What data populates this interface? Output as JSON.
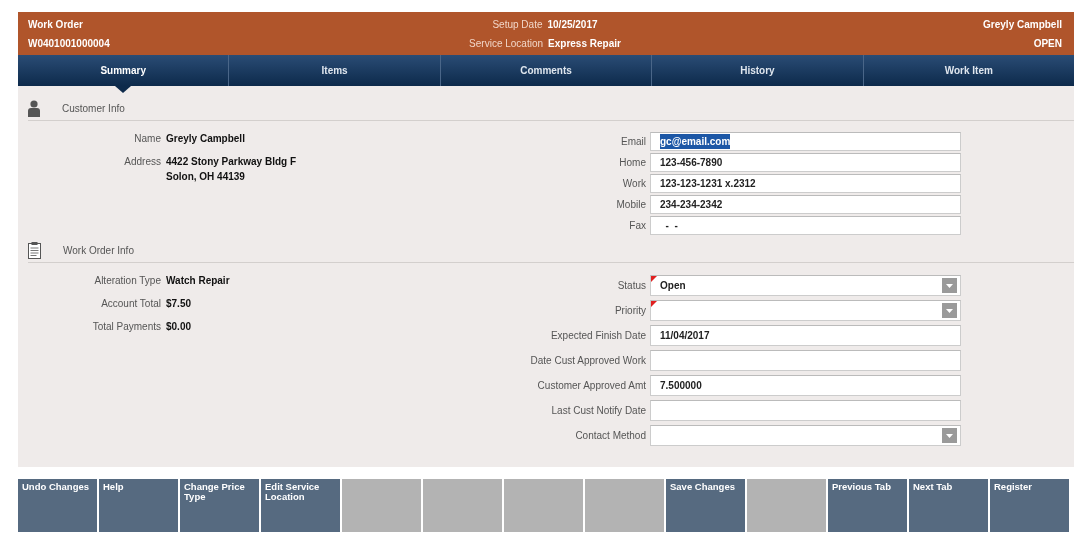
{
  "header": {
    "title": "Work Order",
    "number": "W0401001000004",
    "setup_date_label": "Setup Date",
    "setup_date": "10/25/2017",
    "service_location_label": "Service Location",
    "service_location": "Express Repair",
    "customer": "Greyly Campbell",
    "status": "OPEN"
  },
  "tabs": [
    {
      "label": "Summary",
      "selected": true
    },
    {
      "label": "Items",
      "selected": false
    },
    {
      "label": "Comments",
      "selected": false
    },
    {
      "label": "History",
      "selected": false
    },
    {
      "label": "Work Item",
      "selected": false
    }
  ],
  "sections": [
    {
      "kind": "customer",
      "title": "Customer Info",
      "details": [
        {
          "label": "Name",
          "value": "Greyly Campbell"
        },
        {
          "label": "Address",
          "lines": [
            "4422 Stony Parkway Bldg F",
            "Solon, OH 44139"
          ]
        }
      ],
      "fields": [
        {
          "label": "Email",
          "kind": "text",
          "value": "gc@email.com",
          "selected": true
        },
        {
          "label": "Home",
          "kind": "text",
          "value": "123-456-7890",
          "selected": false
        },
        {
          "label": "Work",
          "kind": "text",
          "value": "123-123-1231 x.2312",
          "selected": false
        },
        {
          "label": "Mobile",
          "kind": "text",
          "value": "234-234-2342",
          "selected": false
        },
        {
          "label": "Fax",
          "kind": "text",
          "value": "  -  -",
          "selected": false
        }
      ]
    },
    {
      "kind": "work_order",
      "title": "Work Order Info",
      "details": [
        {
          "label": "Alteration Type",
          "value": "Watch Repair"
        },
        {
          "label": "Account Total",
          "value": "$7.50"
        },
        {
          "label": "Total Payments",
          "value": "$0.00"
        }
      ],
      "fields": [
        {
          "label": "Status",
          "kind": "select",
          "value": "Open",
          "required": true
        },
        {
          "label": "Priority",
          "kind": "select",
          "required": true
        },
        {
          "label": "Expected Finish Date",
          "kind": "text",
          "value": "11/04/2017"
        },
        {
          "label": "Date Cust Approved Work",
          "kind": "text"
        },
        {
          "label": "Customer Approved Amt",
          "kind": "text",
          "value": "7.500000"
        },
        {
          "label": "Last Cust Notify Date",
          "kind": "text"
        },
        {
          "label": "Contact Method",
          "kind": "select"
        }
      ]
    }
  ],
  "buttons": [
    {
      "label": "Undo Changes",
      "disabled": false
    },
    {
      "label": "Help",
      "disabled": false
    },
    {
      "label": "Change Price Type",
      "disabled": false
    },
    {
      "label": "Edit Service Location",
      "disabled": false
    },
    {
      "disabled": true
    },
    {
      "disabled": true
    },
    {
      "disabled": true
    },
    {
      "disabled": true
    },
    {
      "label": "Save Changes",
      "disabled": false
    },
    {
      "disabled": true
    },
    {
      "label": "Previous Tab",
      "disabled": false
    },
    {
      "label": "Next Tab",
      "disabled": false
    },
    {
      "label": "Register",
      "disabled": false
    }
  ]
}
